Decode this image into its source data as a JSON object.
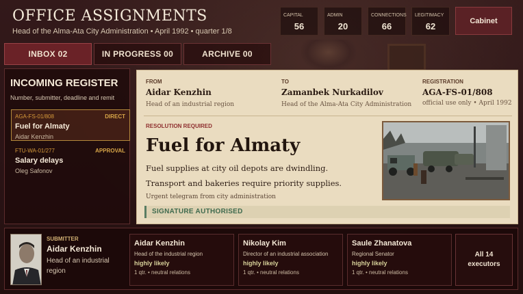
{
  "header": {
    "title": "OFFICE ASSIGNMENTS",
    "subtitle": "Head of the Alma-Ata City Administration  •  April 1992  •  quarter 1/8"
  },
  "stats": [
    {
      "label": "CAPITAL",
      "value": "56"
    },
    {
      "label": "ADMIN",
      "value": "20"
    },
    {
      "label": "CONNECTIONS",
      "value": "66"
    },
    {
      "label": "LEGITIMACY",
      "value": "62"
    }
  ],
  "cabinet_label": "Cabinet",
  "tabs": [
    {
      "label": "INBOX 02",
      "active": true
    },
    {
      "label": "IN PROGRESS 00",
      "active": false
    },
    {
      "label": "ARCHIVE 00",
      "active": false
    }
  ],
  "register": {
    "title": "INCOMING REGISTER",
    "subtitle": "Number, submitter, deadline and remit",
    "items": [
      {
        "code": "AGA-FS-01/808",
        "kind": "DIRECT",
        "title": "Fuel for Almaty",
        "submitter": "Aidar Kenzhin"
      },
      {
        "code": "FTU-WA-01/277",
        "kind": "APPROVAL",
        "title": "Salary delays",
        "submitter": "Oleg Safonov"
      }
    ]
  },
  "document": {
    "from_label": "FROM",
    "from_name": "Aidar Kenzhin",
    "from_role": "Head of an industrial region",
    "to_label": "TO",
    "to_name": "Zamanbek Nurkadilov",
    "to_role": "Head of the Alma-Ata City Administration",
    "reg_label": "REGISTRATION",
    "reg_code": "AGA-FS-01/808",
    "reg_meta": "official use only  •  April 1992",
    "resolution": "RESOLUTION REQUIRED",
    "heading": "Fuel for Almaty",
    "body_1": "Fuel supplies at city oil depots are dwindling.",
    "body_2": "Transport and bakeries require priority supplies.",
    "note": "Urgent telegram from city administration",
    "signed": "SIGNATURE AUTHORISED"
  },
  "submitter": {
    "label": "SUBMITTER",
    "name": "Aidar Kenzhin",
    "role": "Head of an industrial region"
  },
  "executors": [
    {
      "name": "Aidar Kenzhin",
      "role": "Head of the industrial region",
      "likelihood": "highly likely",
      "meta": "1 qtr.  •  neutral relations"
    },
    {
      "name": "Nikolay Kim",
      "role": "Director of an industrial association",
      "likelihood": "highly likely",
      "meta": "1 qtr.  •  neutral relations"
    },
    {
      "name": "Saule Zhanatova",
      "role": "Regional Senator",
      "likelihood": "highly likely",
      "meta": "1 qtr.  •  neutral relations"
    }
  ],
  "all_executors": {
    "line1": "All 14",
    "line2": "executors"
  }
}
